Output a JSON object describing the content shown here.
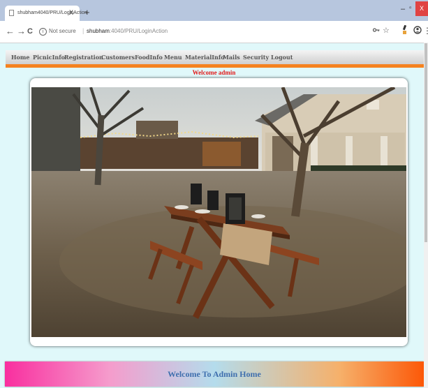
{
  "browser": {
    "tab_title": "shubham4040/PRU/LoginAction",
    "tab_close": "X",
    "new_tab": "+",
    "window_min": "–",
    "window_max": "▫",
    "window_close": "X",
    "back": "←",
    "forward": "→",
    "reload": "C",
    "security_label": "Not secure",
    "url_host": "shubham",
    "url_path": ":4040/PRU/LoginAction",
    "menu": "⋮"
  },
  "nav": {
    "items": [
      {
        "label": "Home"
      },
      {
        "label": "PicnicInfo"
      },
      {
        "label": "Registration"
      },
      {
        "label": "Customers"
      },
      {
        "label": "FoodInfo"
      },
      {
        "label": "Menu"
      },
      {
        "label": "MaterialInfo"
      },
      {
        "label": "Mails"
      },
      {
        "label": "Security"
      },
      {
        "label": "Logout"
      }
    ]
  },
  "page": {
    "welcome": "Welcome admin",
    "banner": "Welcome To Admin Home"
  },
  "colors": {
    "nav_accent": "#f5821f",
    "welcome_text": "#e01b1b",
    "banner_text": "#3f6fae",
    "page_bg": "#e0f8fa"
  }
}
